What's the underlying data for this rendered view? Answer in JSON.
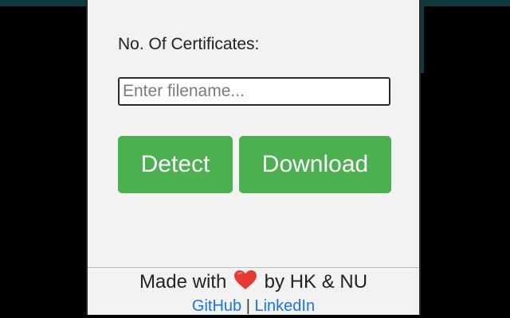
{
  "popup": {
    "certificates_label": "No. Of Certificates:",
    "filename_input": {
      "value": "",
      "placeholder": "Enter filename..."
    },
    "detect_label": "Detect",
    "download_label": "Download"
  },
  "footer": {
    "made_with": "Made with",
    "heart_icon": "heart-icon",
    "by_authors": "by HK & NU",
    "github_label": "GitHub",
    "separator": "|",
    "linkedin_label": "LinkedIn"
  },
  "colors": {
    "button_green": "#4caf50",
    "link_blue": "#1a73e8",
    "heart_red": "#e53935"
  }
}
